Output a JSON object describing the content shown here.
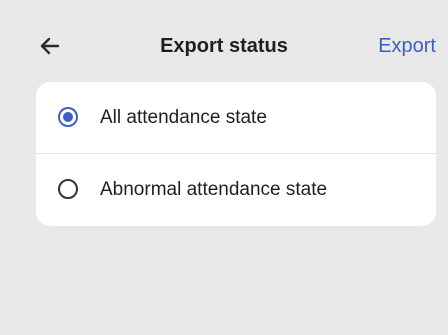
{
  "header": {
    "back_icon": "arrow-left-icon",
    "title": "Export status",
    "export_label": "Export"
  },
  "options": [
    {
      "label": "All attendance state",
      "selected": true
    },
    {
      "label": "Abnormal attendance state",
      "selected": false
    }
  ],
  "colors": {
    "background": "#e8e8e8",
    "card": "#ffffff",
    "accent": "#3b5fc4",
    "text": "#1f1f1f"
  }
}
